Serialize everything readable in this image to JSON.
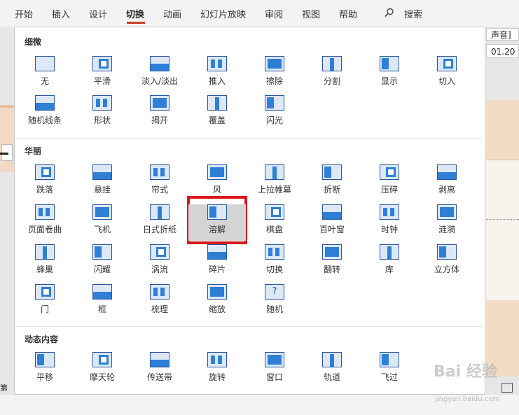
{
  "ribbon": {
    "tabs": [
      "开始",
      "插入",
      "设计",
      "切换",
      "动画",
      "幻灯片放映",
      "审阅",
      "视图",
      "帮助"
    ],
    "search_label": "搜索",
    "active_tab": "切换"
  },
  "right_panel": {
    "sound_label": "声音]",
    "duration_value": "01.20"
  },
  "status": {
    "left_text": "第"
  },
  "sections": [
    {
      "title": "细微",
      "items": [
        "无",
        "平滑",
        "淡入/淡出",
        "推入",
        "擦除",
        "分割",
        "显示",
        "切入",
        "随机线条",
        "形状",
        "揭开",
        "覆盖",
        "闪光"
      ]
    },
    {
      "title": "华丽",
      "items": [
        "跌落",
        "悬挂",
        "帘式",
        "风",
        "上拉帷幕",
        "折断",
        "压碎",
        "剥离",
        "页面卷曲",
        "飞机",
        "日式折纸",
        "溶解",
        "棋盘",
        "百叶窗",
        "时钟",
        "涟漪",
        "蜂巢",
        "闪耀",
        "涡流",
        "碎片",
        "切换",
        "翻转",
        "库",
        "立方体",
        "门",
        "框",
        "梳理",
        "缩放",
        "随机"
      ]
    },
    {
      "title": "动态内容",
      "items": [
        "平移",
        "摩天轮",
        "传送带",
        "旋转",
        "窗口",
        "轨道",
        "飞过"
      ]
    }
  ],
  "selected_item": "溶解",
  "watermark": {
    "text": "Bai 经验",
    "sub": "jingyan.baidu.com"
  },
  "colors": {
    "accent": "#c43e1c",
    "highlight": "#d7191c",
    "icon_border": "#2b579a",
    "icon_fill": "#2f7fd6"
  }
}
